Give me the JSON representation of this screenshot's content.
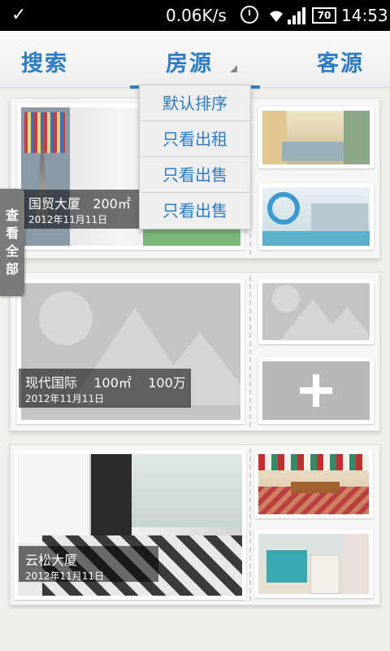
{
  "status_bar": {
    "speed": "0.06K/s",
    "battery": "70",
    "time": "14:53"
  },
  "header": {
    "tab_search": "搜索",
    "tab_house": "房源",
    "tab_client": "客源"
  },
  "dropdown": {
    "items": [
      "默认排序",
      "只看出租",
      "只看出售",
      "只看出售"
    ]
  },
  "side_tab": {
    "label": [
      "查",
      "看",
      "全",
      "部"
    ]
  },
  "listings": [
    {
      "name": "国贸大厦",
      "area": "200㎡",
      "price": "",
      "date": "2012年11月11日"
    },
    {
      "name": "现代国际",
      "area": "100㎡",
      "price": "100万",
      "date": "2012年11月11日"
    },
    {
      "name": "云松大厦",
      "area": "",
      "price": "",
      "date": "2012年11月11日"
    }
  ],
  "colors": {
    "accent": "#2e7cc1",
    "background": "#efeee8"
  }
}
